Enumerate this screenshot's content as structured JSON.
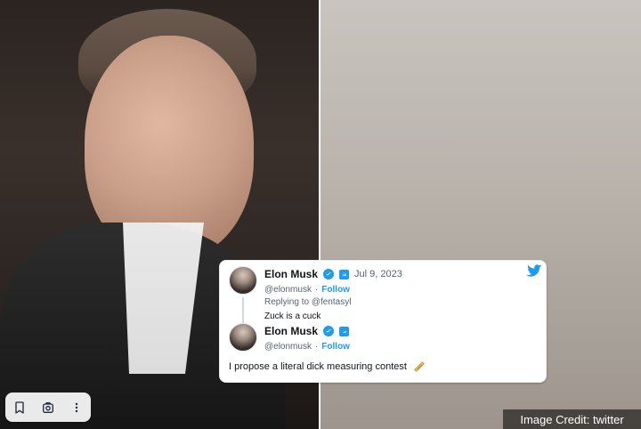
{
  "tweet_card": {
    "tweet1": {
      "name": "Elon Musk",
      "date": "Jul 9, 2023",
      "handle": "@elonmusk",
      "separator": "·",
      "follow": "Follow",
      "reply_prefix": "Replying to",
      "reply_to": "@fentasyl",
      "text": "Zuck is a cuck"
    },
    "tweet2": {
      "name": "Elon Musk",
      "handle": "@elonmusk",
      "separator": "·",
      "follow": "Follow",
      "text": "I propose a literal dick measuring contest"
    }
  },
  "image_credit": "Image Credit: twitter",
  "icons": {
    "twitter": "twitter-bird-icon",
    "verified": "verified-check-icon",
    "badge": "square-badge-icon",
    "ruler": "ruler-emoji-icon",
    "bookmark": "bookmark-icon",
    "lens": "lens-icon",
    "more": "more-vertical-icon"
  },
  "colors": {
    "twitter_blue": "#1d9bf0",
    "text_primary": "#0f1419",
    "text_secondary": "#536471"
  }
}
